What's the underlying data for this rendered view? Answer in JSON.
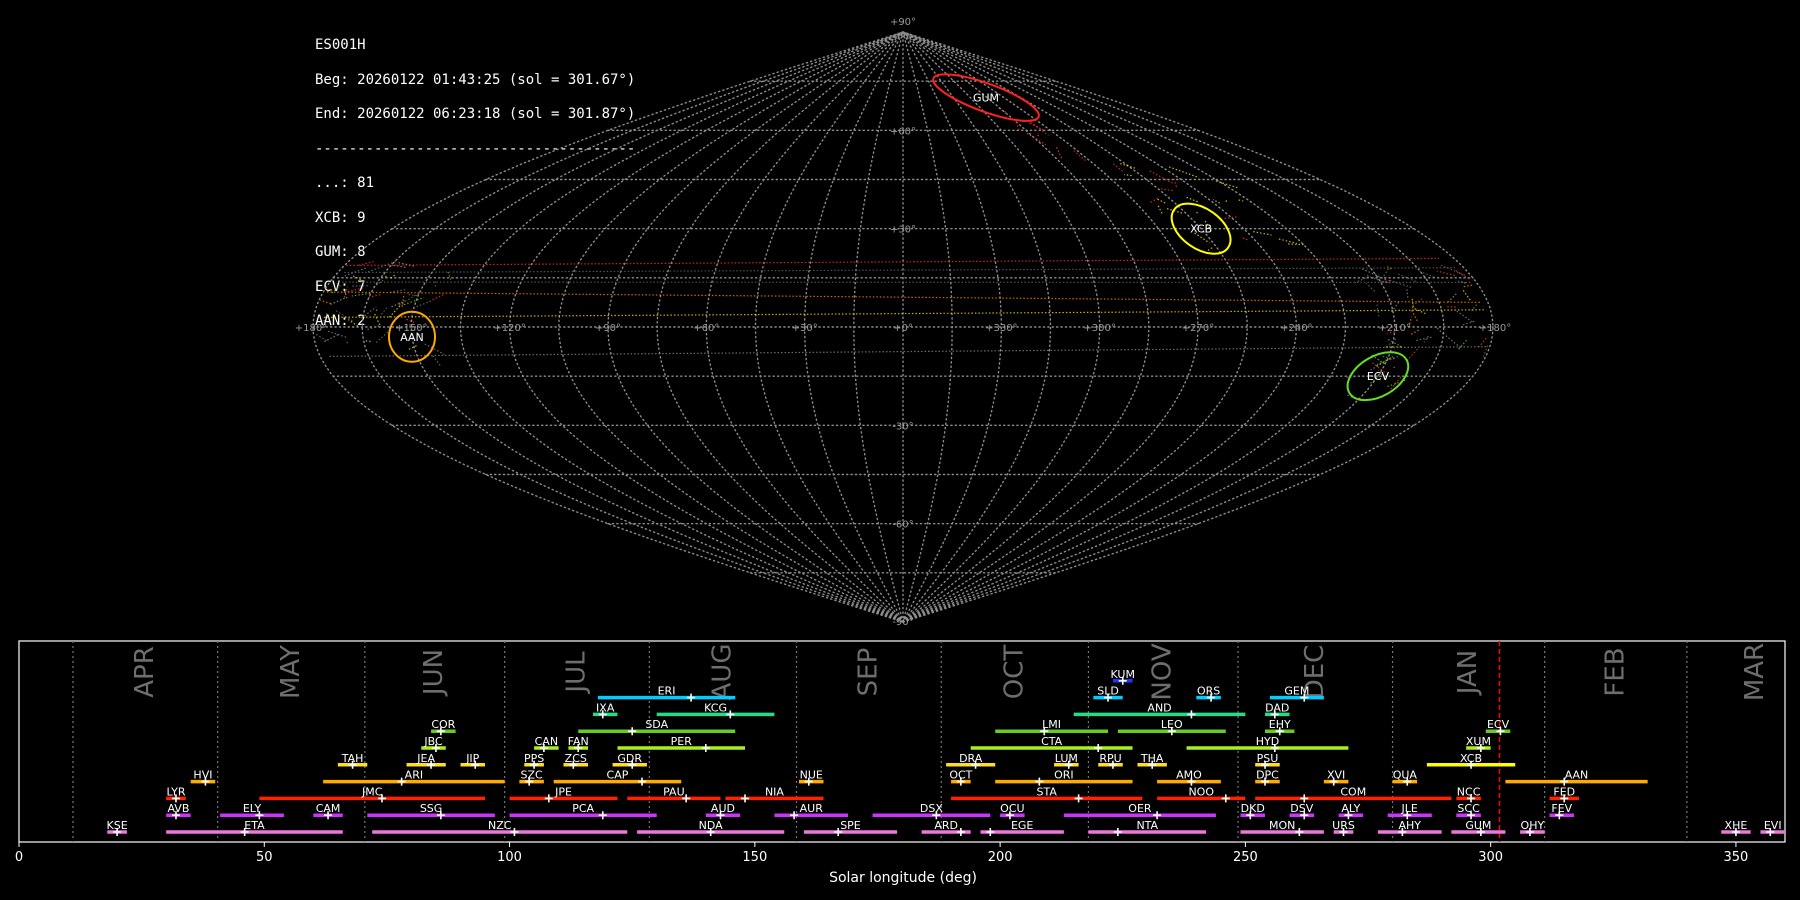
{
  "header": {
    "station": "ES001H",
    "begin": "Beg: 20260122 01:43:25 (sol = 301.67°)",
    "end": "End: 20260122 06:23:18 (sol = 301.87°)",
    "separator": "--------------------------------------",
    "counts": [
      {
        "label": "...: 81"
      },
      {
        "label": "XCB: 9"
      },
      {
        "label": "GUM: 8"
      },
      {
        "label": "ECV: 7"
      },
      {
        "label": "AAN: 2"
      }
    ]
  },
  "colors": {
    "background": "#000000",
    "grid": "#8c8c8c",
    "current_line": "#ff0000"
  },
  "chart_data": [
    {
      "type": "scatter",
      "projection": "sinusoidal",
      "grid": true,
      "lon_labels": [
        "+180°",
        "+150°",
        "+120°",
        "+90°",
        "+60°",
        "+30°",
        "+0°",
        "+330°",
        "+300°",
        "+270°",
        "+240°",
        "+210°",
        "+180°"
      ],
      "lat_labels": [
        "+90°",
        "+60°",
        "+30°",
        "-30°",
        "-60°",
        "-90°"
      ],
      "showers": [
        {
          "code": "GUM",
          "lon": 286,
          "lat": 70,
          "color": "#ff2020"
        },
        {
          "code": "XCB",
          "lon": 255,
          "lat": 30,
          "color": "#ffff00"
        },
        {
          "code": "AAN",
          "lon": 150,
          "lat": -3,
          "color": "#ffaa00"
        },
        {
          "code": "ECV",
          "lon": 210,
          "lat": -15,
          "color": "#66dd22"
        }
      ]
    },
    {
      "type": "timeline",
      "xlabel": "Solar longitude (deg)",
      "xlim": [
        0,
        360
      ],
      "xticks": [
        "0",
        "50",
        "100",
        "150",
        "200",
        "250",
        "300",
        "350"
      ],
      "current_sol": 301.8,
      "months": [
        {
          "name": "APR",
          "start": 11,
          "end": 40.5
        },
        {
          "name": "MAY",
          "start": 40.5,
          "end": 70.5
        },
        {
          "name": "JUN",
          "start": 70.5,
          "end": 99
        },
        {
          "name": "JUL",
          "start": 99,
          "end": 128.5
        },
        {
          "name": "AUG",
          "start": 128.5,
          "end": 158.5
        },
        {
          "name": "SEP",
          "start": 158.5,
          "end": 188
        },
        {
          "name": "OCT",
          "start": 188,
          "end": 218
        },
        {
          "name": "NOV",
          "start": 218,
          "end": 248.5
        },
        {
          "name": "DEC",
          "start": 248.5,
          "end": 280
        },
        {
          "name": "JAN",
          "start": 280,
          "end": 311
        },
        {
          "name": "FEB",
          "start": 311,
          "end": 340
        },
        {
          "name": "MAR",
          "start": 340,
          "end": 371
        }
      ],
      "showers": [
        {
          "code": "KUM",
          "start": 223,
          "end": 227,
          "peak": 225,
          "row": 10,
          "color": "#2233ff"
        },
        {
          "code": "ERI",
          "start": 118,
          "end": 146,
          "peak": 137,
          "row": 9,
          "color": "#00ccff"
        },
        {
          "code": "SLD",
          "start": 219,
          "end": 225,
          "peak": 222,
          "row": 9,
          "color": "#00ccff"
        },
        {
          "code": "ORS",
          "start": 240,
          "end": 245,
          "peak": 243,
          "row": 9,
          "color": "#00ccff"
        },
        {
          "code": "GEM",
          "start": 255,
          "end": 266,
          "peak": 262,
          "row": 9,
          "color": "#00ccff"
        },
        {
          "code": "IXA",
          "start": 117,
          "end": 122,
          "peak": 119,
          "row": 8,
          "color": "#22dd88"
        },
        {
          "code": "KCG",
          "start": 130,
          "end": 154,
          "peak": 145,
          "row": 8,
          "color": "#22dd88"
        },
        {
          "code": "AND",
          "start": 215,
          "end": 250,
          "peak": 239,
          "row": 8,
          "color": "#22dd88"
        },
        {
          "code": "DAD",
          "start": 254,
          "end": 259,
          "peak": 256,
          "row": 8,
          "color": "#22dd88"
        },
        {
          "code": "COR",
          "start": 84,
          "end": 89,
          "peak": 86,
          "row": 7,
          "color": "#66cc22"
        },
        {
          "code": "SDA",
          "start": 114,
          "end": 146,
          "peak": 125,
          "row": 7,
          "color": "#66cc22"
        },
        {
          "code": "LMI",
          "start": 199,
          "end": 222,
          "peak": 209,
          "row": 7,
          "color": "#66cc22"
        },
        {
          "code": "LEO",
          "start": 224,
          "end": 246,
          "peak": 235,
          "row": 7,
          "color": "#66cc22"
        },
        {
          "code": "EHY",
          "start": 254,
          "end": 260,
          "peak": 257,
          "row": 7,
          "color": "#66cc22"
        },
        {
          "code": "ECV",
          "start": 299,
          "end": 304,
          "peak": 302,
          "row": 7,
          "color": "#66cc22"
        },
        {
          "code": "JBC",
          "start": 82,
          "end": 87,
          "peak": 85,
          "row": 6,
          "color": "#aaee22"
        },
        {
          "code": "CAN",
          "start": 105,
          "end": 110,
          "peak": 107,
          "row": 6,
          "color": "#aaee22"
        },
        {
          "code": "FAN",
          "start": 112,
          "end": 116,
          "peak": 114,
          "row": 6,
          "color": "#aaee22"
        },
        {
          "code": "PER",
          "start": 122,
          "end": 148,
          "peak": 140,
          "row": 6,
          "color": "#aaee22"
        },
        {
          "code": "CTA",
          "start": 194,
          "end": 227,
          "peak": 220,
          "row": 6,
          "color": "#aaee22"
        },
        {
          "code": "HYD",
          "start": 238,
          "end": 271,
          "peak": 256,
          "row": 6,
          "color": "#aaee22"
        },
        {
          "code": "XUM",
          "start": 295,
          "end": 300,
          "peak": 298,
          "row": 6,
          "color": "#aaee22"
        },
        {
          "code": "TAH",
          "start": 65,
          "end": 71,
          "peak": 68,
          "row": 5,
          "color": "#ffdd22"
        },
        {
          "code": "JEA",
          "start": 79,
          "end": 87,
          "peak": 84,
          "row": 5,
          "color": "#ffdd22"
        },
        {
          "code": "JIP",
          "start": 90,
          "end": 95,
          "peak": 93,
          "row": 5,
          "color": "#ffdd22"
        },
        {
          "code": "PPS",
          "start": 103,
          "end": 107,
          "peak": 105,
          "row": 5,
          "color": "#ffdd22"
        },
        {
          "code": "ZCS",
          "start": 111,
          "end": 116,
          "peak": 113,
          "row": 5,
          "color": "#ffdd22"
        },
        {
          "code": "GDR",
          "start": 121,
          "end": 128,
          "peak": 125,
          "row": 5,
          "color": "#ffdd22"
        },
        {
          "code": "DRA",
          "start": 189,
          "end": 199,
          "peak": 195,
          "row": 5,
          "color": "#ffdd22"
        },
        {
          "code": "LUM",
          "start": 211,
          "end": 216,
          "peak": 214,
          "row": 5,
          "color": "#ffdd22"
        },
        {
          "code": "RPU",
          "start": 220,
          "end": 225,
          "peak": 223,
          "row": 5,
          "color": "#ffdd22"
        },
        {
          "code": "THA",
          "start": 228,
          "end": 234,
          "peak": 231,
          "row": 5,
          "color": "#ffdd22"
        },
        {
          "code": "PSU",
          "start": 252,
          "end": 257,
          "peak": 254,
          "row": 5,
          "color": "#ffdd22"
        },
        {
          "code": "XCB",
          "start": 287,
          "end": 305,
          "peak": 296,
          "row": 5,
          "color": "#ffff00"
        },
        {
          "code": "HVI",
          "start": 35,
          "end": 40,
          "peak": 38,
          "row": 4,
          "color": "#ffaa00"
        },
        {
          "code": "ARI",
          "start": 62,
          "end": 99,
          "peak": 78,
          "row": 4,
          "color": "#ffaa00"
        },
        {
          "code": "SZC",
          "start": 102,
          "end": 107,
          "peak": 104,
          "row": 4,
          "color": "#ffaa00"
        },
        {
          "code": "CAP",
          "start": 109,
          "end": 135,
          "peak": 127,
          "row": 4,
          "color": "#ffaa00"
        },
        {
          "code": "NUE",
          "start": 159,
          "end": 164,
          "peak": 161,
          "row": 4,
          "color": "#ffaa00"
        },
        {
          "code": "OCT",
          "start": 190,
          "end": 194,
          "peak": 192,
          "row": 4,
          "color": "#ffaa00"
        },
        {
          "code": "ORI",
          "start": 199,
          "end": 227,
          "peak": 208,
          "row": 4,
          "color": "#ffaa00"
        },
        {
          "code": "AMO",
          "start": 232,
          "end": 245,
          "peak": 239,
          "row": 4,
          "color": "#ffaa00"
        },
        {
          "code": "DPC",
          "start": 252,
          "end": 257,
          "peak": 254,
          "row": 4,
          "color": "#ffaa00"
        },
        {
          "code": "XVI",
          "start": 266,
          "end": 271,
          "peak": 268,
          "row": 4,
          "color": "#ffaa00"
        },
        {
          "code": "QUA",
          "start": 280,
          "end": 285,
          "peak": 283,
          "row": 4,
          "color": "#ffaa00"
        },
        {
          "code": "AAN",
          "start": 303,
          "end": 332,
          "peak": 315,
          "row": 4,
          "color": "#ffaa00"
        },
        {
          "code": "LYR",
          "start": 30,
          "end": 34,
          "peak": 32,
          "row": 3,
          "color": "#ff2200"
        },
        {
          "code": "JMC",
          "start": 49,
          "end": 95,
          "peak": 74,
          "row": 3,
          "color": "#ff2200"
        },
        {
          "code": "JPE",
          "start": 100,
          "end": 122,
          "peak": 108,
          "row": 3,
          "color": "#ff2200"
        },
        {
          "code": "PAU",
          "start": 124,
          "end": 143,
          "peak": 136,
          "row": 3,
          "color": "#ff2200"
        },
        {
          "code": "NIA",
          "start": 144,
          "end": 164,
          "peak": 148,
          "row": 3,
          "color": "#ff2200"
        },
        {
          "code": "STA",
          "start": 190,
          "end": 229,
          "peak": 216,
          "row": 3,
          "color": "#ff2200"
        },
        {
          "code": "NOO",
          "start": 232,
          "end": 250,
          "peak": 246,
          "row": 3,
          "color": "#ff2200"
        },
        {
          "code": "COM",
          "start": 252,
          "end": 292,
          "peak": 262,
          "row": 3,
          "color": "#ff2200"
        },
        {
          "code": "NCC",
          "start": 293,
          "end": 298,
          "peak": 296,
          "row": 3,
          "color": "#ff2200"
        },
        {
          "code": "FED",
          "start": 312,
          "end": 318,
          "peak": 315,
          "row": 3,
          "color": "#ff2200"
        },
        {
          "code": "AVB",
          "start": 30,
          "end": 35,
          "peak": 32,
          "row": 2,
          "color": "#cc33ff"
        },
        {
          "code": "ELY",
          "start": 41,
          "end": 54,
          "peak": 49,
          "row": 2,
          "color": "#cc33ff"
        },
        {
          "code": "CAM",
          "start": 60,
          "end": 66,
          "peak": 63,
          "row": 2,
          "color": "#cc33ff"
        },
        {
          "code": "SSG",
          "start": 71,
          "end": 97,
          "peak": 86,
          "row": 2,
          "color": "#cc33ff"
        },
        {
          "code": "PCA",
          "start": 100,
          "end": 130,
          "peak": 119,
          "row": 2,
          "color": "#cc33ff"
        },
        {
          "code": "AUD",
          "start": 140,
          "end": 147,
          "peak": 143,
          "row": 2,
          "color": "#cc33ff"
        },
        {
          "code": "AUR",
          "start": 154,
          "end": 169,
          "peak": 158,
          "row": 2,
          "color": "#cc33ff"
        },
        {
          "code": "DSX",
          "start": 174,
          "end": 198,
          "peak": 187,
          "row": 2,
          "color": "#cc33ff"
        },
        {
          "code": "OCU",
          "start": 200,
          "end": 205,
          "peak": 202,
          "row": 2,
          "color": "#cc33ff"
        },
        {
          "code": "OER",
          "start": 213,
          "end": 244,
          "peak": 232,
          "row": 2,
          "color": "#cc33ff"
        },
        {
          "code": "DKD",
          "start": 249,
          "end": 254,
          "peak": 251,
          "row": 2,
          "color": "#cc33ff"
        },
        {
          "code": "DSV",
          "start": 259,
          "end": 264,
          "peak": 262,
          "row": 2,
          "color": "#cc33ff"
        },
        {
          "code": "ALY",
          "start": 269,
          "end": 274,
          "peak": 271,
          "row": 2,
          "color": "#cc33ff"
        },
        {
          "code": "JLE",
          "start": 279,
          "end": 288,
          "peak": 283,
          "row": 2,
          "color": "#cc33ff"
        },
        {
          "code": "SCC",
          "start": 293,
          "end": 298,
          "peak": 296,
          "row": 2,
          "color": "#cc33ff"
        },
        {
          "code": "FEV",
          "start": 312,
          "end": 317,
          "peak": 314,
          "row": 2,
          "color": "#cc33ff"
        },
        {
          "code": "KSE",
          "start": 18,
          "end": 22,
          "peak": 20,
          "row": 1,
          "color": "#ee77dd"
        },
        {
          "code": "ETA",
          "start": 30,
          "end": 66,
          "peak": 46,
          "row": 1,
          "color": "#ee77dd"
        },
        {
          "code": "NZC",
          "start": 72,
          "end": 124,
          "peak": 101,
          "row": 1,
          "color": "#ee77dd"
        },
        {
          "code": "NDA",
          "start": 126,
          "end": 156,
          "peak": 141,
          "row": 1,
          "color": "#ee77dd"
        },
        {
          "code": "SPE",
          "start": 160,
          "end": 179,
          "peak": 167,
          "row": 1,
          "color": "#ee77dd"
        },
        {
          "code": "ARD",
          "start": 184,
          "end": 194,
          "peak": 192,
          "row": 1,
          "color": "#ee77dd"
        },
        {
          "code": "EGE",
          "start": 196,
          "end": 213,
          "peak": 198,
          "row": 1,
          "color": "#ee77dd"
        },
        {
          "code": "NTA",
          "start": 218,
          "end": 242,
          "peak": 224,
          "row": 1,
          "color": "#ee77dd"
        },
        {
          "code": "MON",
          "start": 249,
          "end": 266,
          "peak": 261,
          "row": 1,
          "color": "#ee77dd"
        },
        {
          "code": "URS",
          "start": 268,
          "end": 272,
          "peak": 270,
          "row": 1,
          "color": "#ee77dd"
        },
        {
          "code": "AHY",
          "start": 277,
          "end": 290,
          "peak": 282,
          "row": 1,
          "color": "#ee77dd"
        },
        {
          "code": "GUM",
          "start": 292,
          "end": 303,
          "peak": 298,
          "row": 1,
          "color": "#ee77dd"
        },
        {
          "code": "OHY",
          "start": 306,
          "end": 311,
          "peak": 308,
          "row": 1,
          "color": "#ee77dd"
        },
        {
          "code": "XHE",
          "start": 347,
          "end": 353,
          "peak": 350,
          "row": 1,
          "color": "#ee77dd"
        },
        {
          "code": "EVI",
          "start": 355,
          "end": 360,
          "peak": 357,
          "row": 1,
          "color": "#ee77dd"
        }
      ]
    }
  ]
}
